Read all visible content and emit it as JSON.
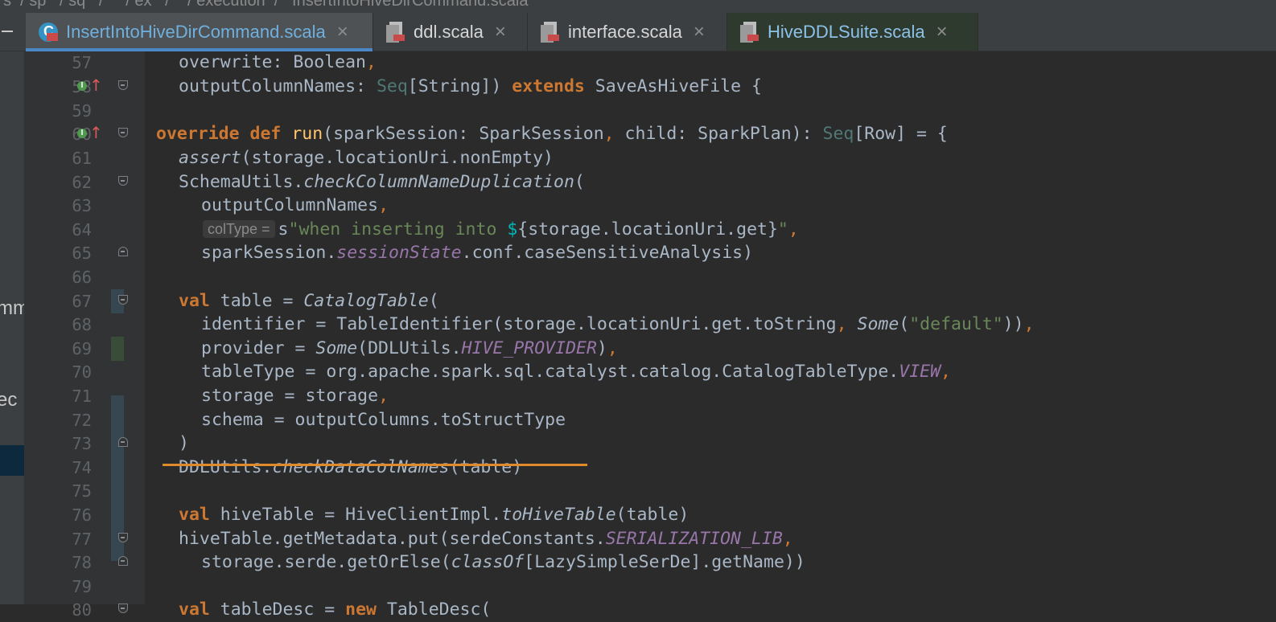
{
  "breadcrumb": {
    "text": "s  / sp   / sq   /     / ex   /    / execution  /   InsertIntoHiveDirCommand.scala"
  },
  "tabs": [
    {
      "label": "InsertIntoHiveDirCommand.scala",
      "icon": "scala-class-icon",
      "active": true
    },
    {
      "label": "ddl.scala",
      "icon": "scala-file-icon",
      "active": false
    },
    {
      "label": "interface.scala",
      "icon": "scala-file-icon",
      "active": false
    },
    {
      "label": "HiveDDLSuite.scala",
      "icon": "scala-file-icon",
      "active": false
    }
  ],
  "left_panel": {
    "snippet_1": "mm",
    "snippet_2": "ec"
  },
  "inlay_hint": "colType =",
  "lines": [
    {
      "n": "57",
      "text": "overwrite: Boolean,"
    },
    {
      "n": "58",
      "text": "outputColumnNames: Seq[String]) extends SaveAsHiveFile {"
    },
    {
      "n": "59",
      "text": ""
    },
    {
      "n": "60",
      "text": "override def run(sparkSession: SparkSession, child: SparkPlan): Seq[Row] = {"
    },
    {
      "n": "61",
      "text": "assert(storage.locationUri.nonEmpty)"
    },
    {
      "n": "62",
      "text": "SchemaUtils.checkColumnNameDuplication("
    },
    {
      "n": "63",
      "text": "outputColumnNames,"
    },
    {
      "n": "64",
      "text": "s\"when inserting into ${storage.locationUri.get}\","
    },
    {
      "n": "65",
      "text": "sparkSession.sessionState.conf.caseSensitiveAnalysis)"
    },
    {
      "n": "66",
      "text": ""
    },
    {
      "n": "67",
      "text": "val table = CatalogTable("
    },
    {
      "n": "68",
      "text": "identifier = TableIdentifier(storage.locationUri.get.toString, Some(\"default\")),"
    },
    {
      "n": "69",
      "text": "provider = Some(DDLUtils.HIVE_PROVIDER),"
    },
    {
      "n": "70",
      "text": "tableType = org.apache.spark.sql.catalyst.catalog.CatalogTableType.VIEW,"
    },
    {
      "n": "71",
      "text": "storage = storage,"
    },
    {
      "n": "72",
      "text": "schema = outputColumns.toStructType"
    },
    {
      "n": "73",
      "text": ")"
    },
    {
      "n": "74",
      "text": "DDLUtils.checkDataColNames(table)"
    },
    {
      "n": "75",
      "text": ""
    },
    {
      "n": "76",
      "text": "val hiveTable = HiveClientImpl.toHiveTable(table)"
    },
    {
      "n": "77",
      "text": "hiveTable.getMetadata.put(serdeConstants.SERIALIZATION_LIB,"
    },
    {
      "n": "78",
      "text": "storage.serde.getOrElse(classOf[LazySimpleSerDe].getName))"
    },
    {
      "n": "79",
      "text": ""
    },
    {
      "n": "80",
      "text": "val tableDesc = new TableDesc("
    }
  ],
  "colors": {
    "keyword": "#cc7832",
    "type": "#507874",
    "function_decl": "#ffc66d",
    "string": "#6a8759",
    "property": "#9876aa",
    "default_text": "#a9b7c6",
    "line_number": "#606366",
    "active_tab_text": "#6fb0de",
    "underline": "#e08a2c"
  }
}
